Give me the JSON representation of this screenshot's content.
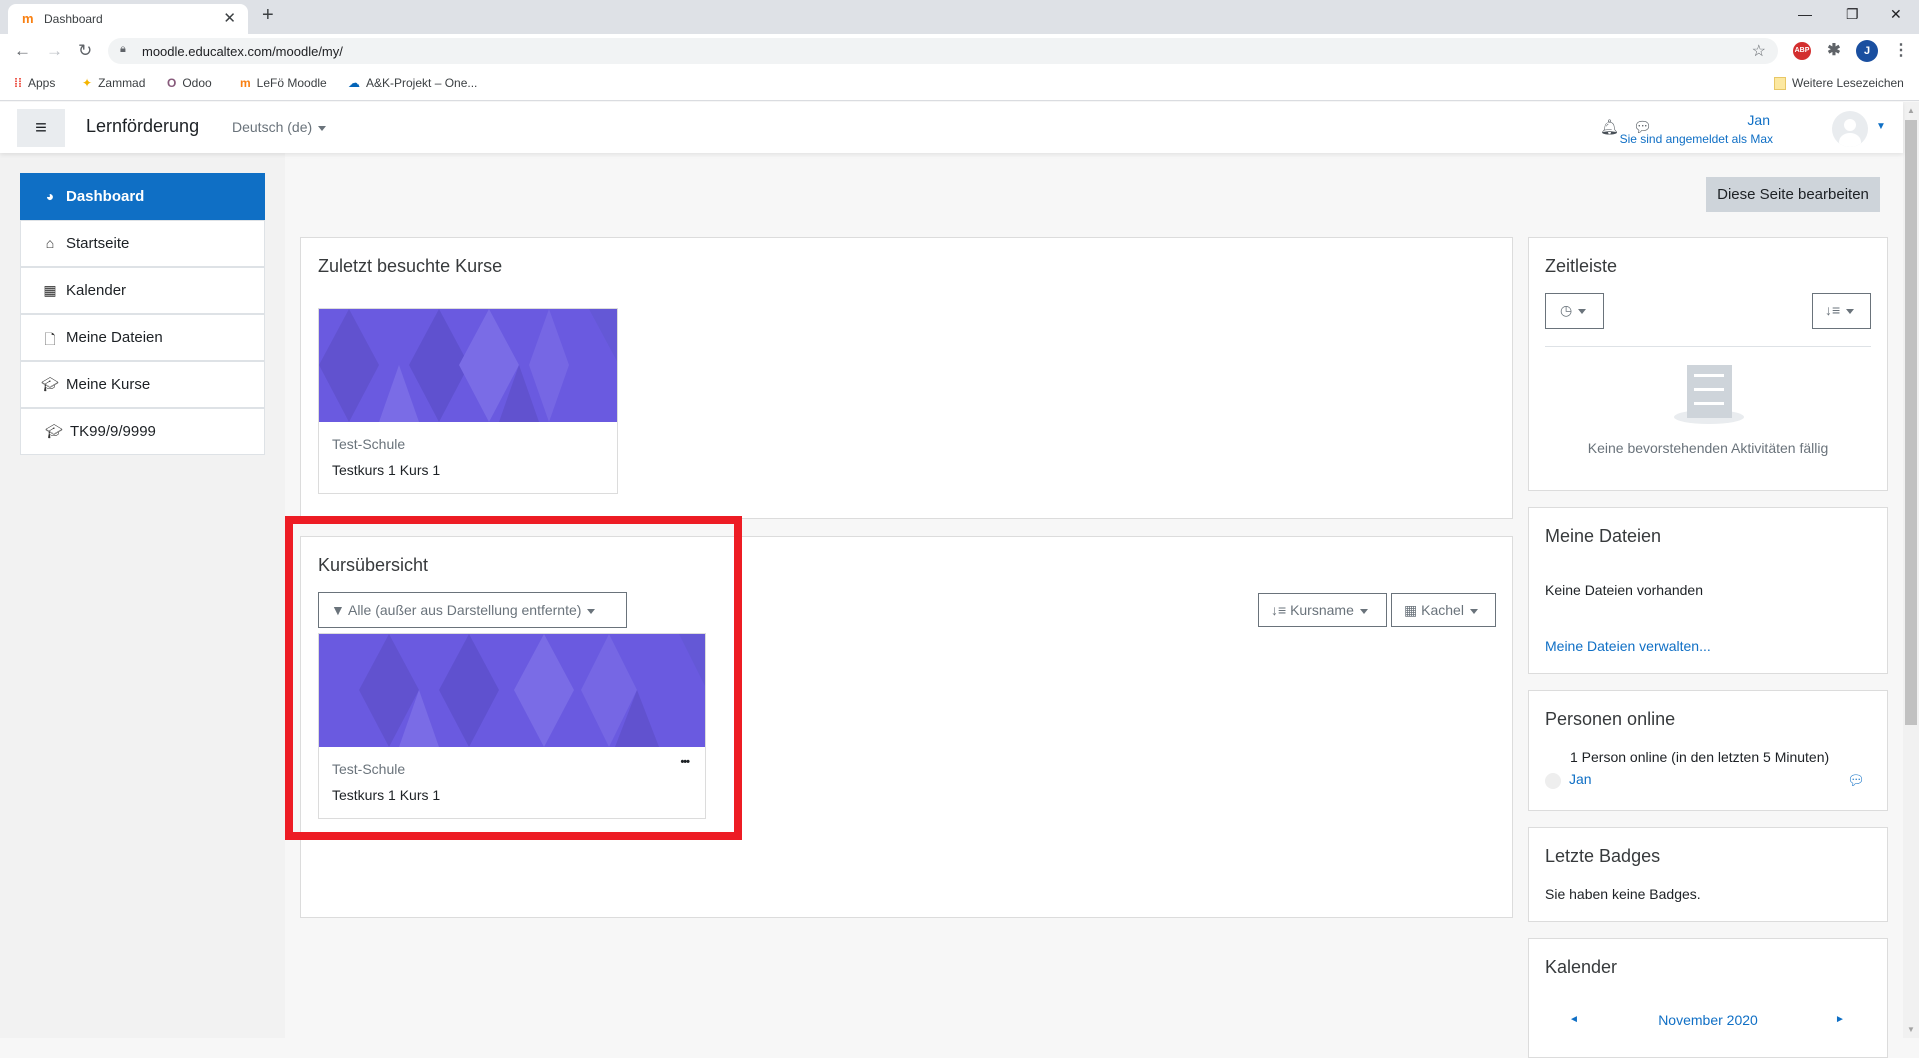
{
  "browser": {
    "tab": {
      "title": "Dashboard",
      "favicon": "moodle-icon"
    },
    "new_tab": "+",
    "window_controls": {
      "minimize": "—",
      "restore": "❐",
      "close": "✕"
    },
    "url": "moodle.educaltex.com/moodle/my/",
    "extensions": [
      {
        "name": "adblock-plus-icon",
        "label": "ABP",
        "color": "#d32f2f"
      },
      {
        "name": "extensions-puzzle-icon",
        "label": "✱",
        "color": "#5f6368"
      },
      {
        "name": "profile-avatar",
        "label": "J",
        "color": "#1a4fa0"
      }
    ],
    "bookmarks": [
      {
        "label": "Apps",
        "icon": "apps-grid-icon"
      },
      {
        "label": "Zammad",
        "icon": "zammad-icon"
      },
      {
        "label": "Odoo",
        "icon": "odoo-icon"
      },
      {
        "label": "LeFö Moodle",
        "icon": "moodle-icon"
      },
      {
        "label": "A&K-Projekt – One...",
        "icon": "onedrive-icon"
      }
    ],
    "other_bookmarks": "Weitere Lesezeichen"
  },
  "navbar": {
    "site_name": "Lernförderung",
    "language": "Deutsch (de)",
    "user_name": "Jan",
    "logged_in_as": "Sie sind angemeldet als Max"
  },
  "sidebar": {
    "items": [
      {
        "label": "Dashboard",
        "icon": "dashboard-icon",
        "active": true
      },
      {
        "label": "Startseite",
        "icon": "home-icon"
      },
      {
        "label": "Kalender",
        "icon": "calendar-icon"
      },
      {
        "label": "Meine Dateien",
        "icon": "file-icon"
      },
      {
        "label": "Meine Kurse",
        "icon": "graduation-cap-icon"
      },
      {
        "label": "TK99/9/9999",
        "icon": "graduation-cap-icon"
      }
    ]
  },
  "main": {
    "edit_button": "Diese Seite bearbeiten",
    "recent_courses": {
      "title": "Zuletzt besuchte Kurse",
      "courses": [
        {
          "category": "Test-Schule",
          "name": "Testkurs 1 Kurs 1"
        }
      ]
    },
    "course_overview": {
      "title": "Kursübersicht",
      "filter": "Alle (außer aus Darstellung entfernte)",
      "sort": "Kursname",
      "view": "Kachel",
      "courses": [
        {
          "category": "Test-Schule",
          "name": "Testkurs 1 Kurs 1",
          "menu": "•••"
        }
      ]
    }
  },
  "blocks": {
    "timeline": {
      "title": "Zeitleiste",
      "empty_text": "Keine bevorstehenden Aktivitäten fällig"
    },
    "my_files": {
      "title": "Meine Dateien",
      "empty_text": "Keine Dateien vorhanden",
      "manage_link": "Meine Dateien verwalten..."
    },
    "online_users": {
      "title": "Personen online",
      "summary": "1 Person online (in den letzten 5 Minuten)",
      "users": [
        "Jan"
      ]
    },
    "badges": {
      "title": "Letzte Badges",
      "text": "Sie haben keine Badges."
    },
    "calendar": {
      "title": "Kalender",
      "month": "November 2020",
      "prev": "◄",
      "next": "►"
    }
  },
  "colors": {
    "brand": "#0f6fc5",
    "highlight": "#ed1c24",
    "course_image": "#6a5ae0"
  }
}
